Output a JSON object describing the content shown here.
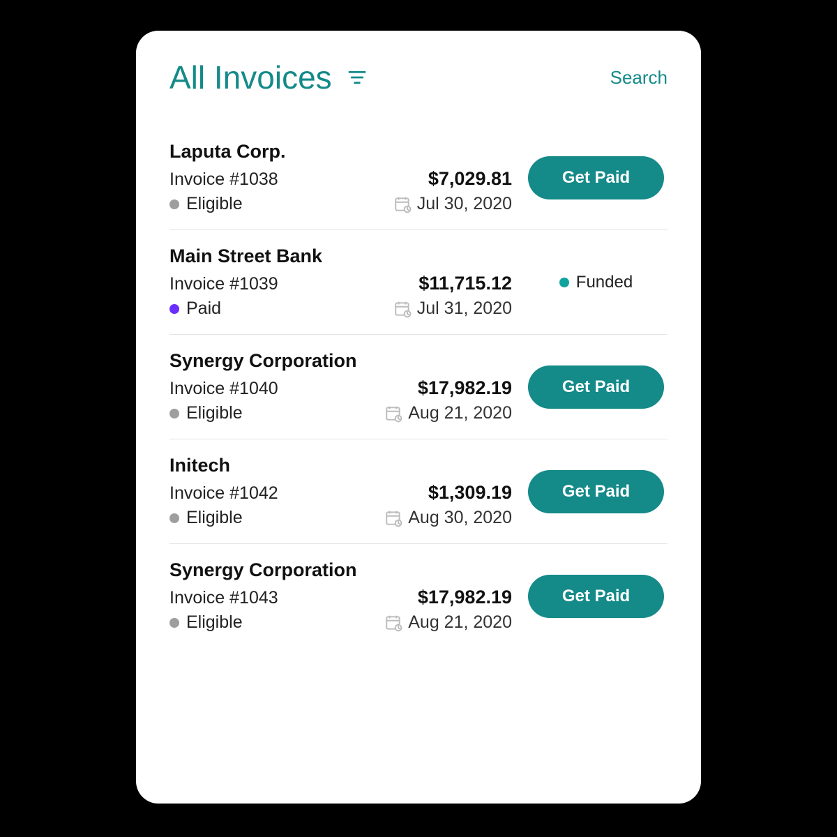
{
  "header": {
    "title": "All Invoices",
    "search_label": "Search"
  },
  "actions": {
    "get_paid_label": "Get Paid",
    "funded_label": "Funded"
  },
  "status_colors": {
    "Eligible": "grey",
    "Paid": "purple",
    "Funded": "teal"
  },
  "invoices": [
    {
      "company": "Laputa Corp.",
      "invoice_no": "Invoice #1038",
      "amount": "$7,029.81",
      "status": "Eligible",
      "date": "Jul 30, 2020",
      "action": "get_paid"
    },
    {
      "company": "Main Street Bank",
      "invoice_no": "Invoice #1039",
      "amount": "$11,715.12",
      "status": "Paid",
      "date": "Jul 31, 2020",
      "action": "funded"
    },
    {
      "company": "Synergy Corporation",
      "invoice_no": "Invoice #1040",
      "amount": "$17,982.19",
      "status": "Eligible",
      "date": "Aug 21, 2020",
      "action": "get_paid"
    },
    {
      "company": "Initech",
      "invoice_no": "Invoice #1042",
      "amount": "$1,309.19",
      "status": "Eligible",
      "date": "Aug 30, 2020",
      "action": "get_paid"
    },
    {
      "company": "Synergy Corporation",
      "invoice_no": "Invoice #1043",
      "amount": "$17,982.19",
      "status": "Eligible",
      "date": "Aug 21, 2020",
      "action": "get_paid"
    }
  ]
}
